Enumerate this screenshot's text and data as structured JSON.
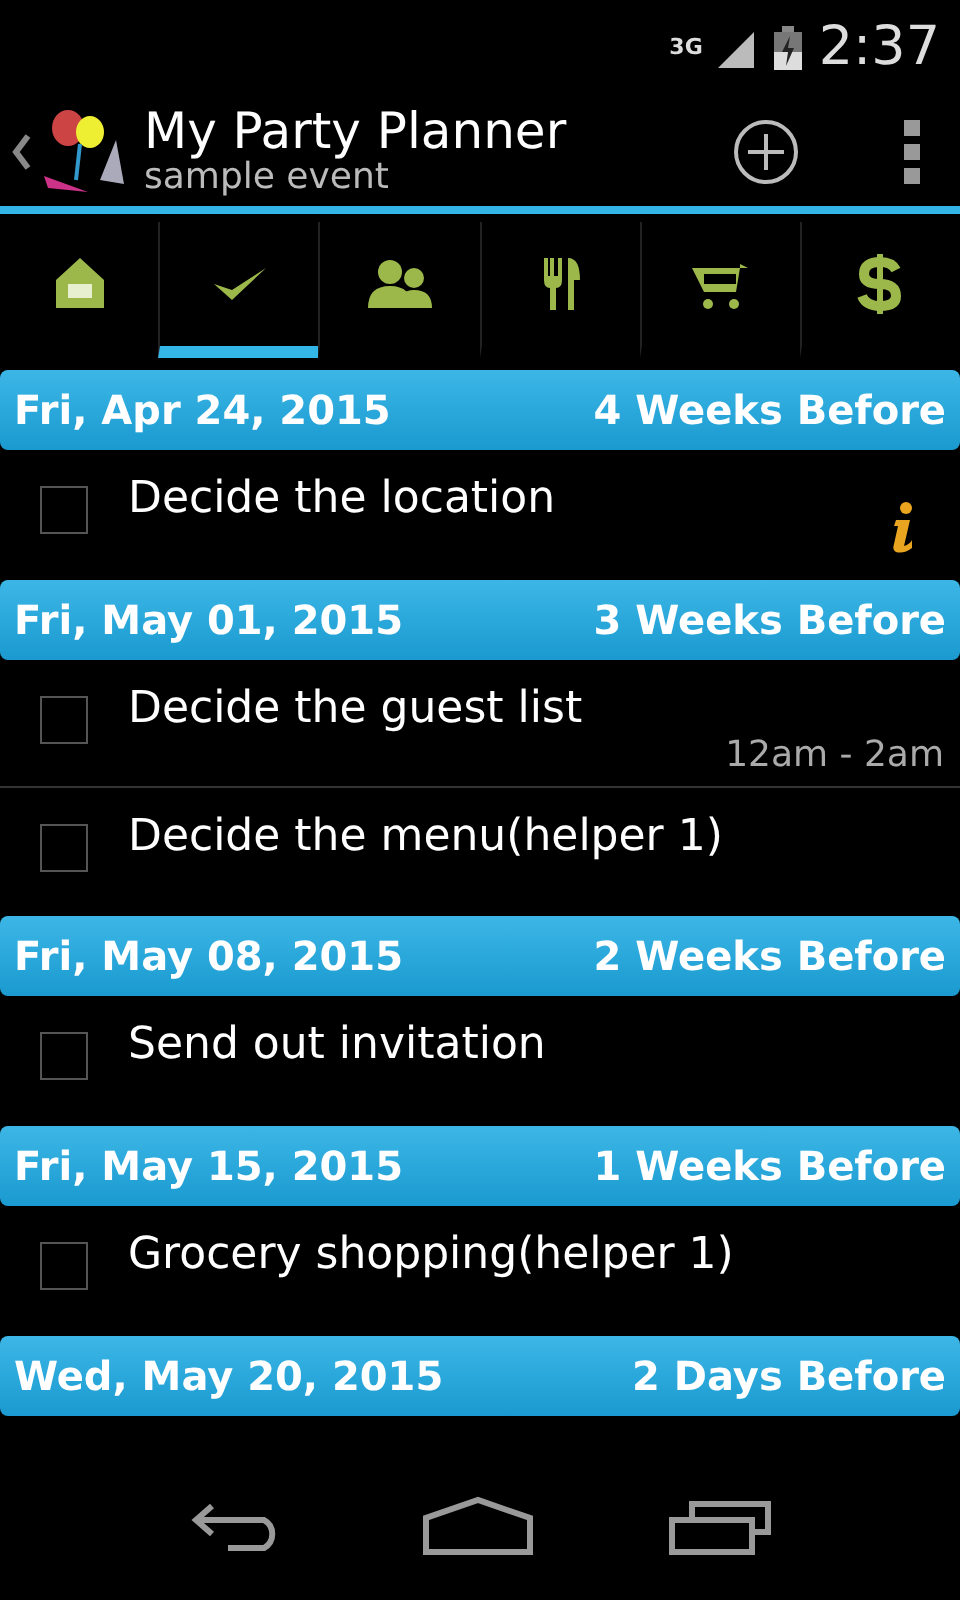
{
  "status_bar": {
    "network": "3G",
    "time": "2:37"
  },
  "action_bar": {
    "title": "My Party Planner",
    "subtitle": "sample event"
  },
  "tabs": [
    {
      "kind": "home",
      "selected": false
    },
    {
      "kind": "tasks",
      "selected": true
    },
    {
      "kind": "guests",
      "selected": false
    },
    {
      "kind": "menu",
      "selected": false
    },
    {
      "kind": "shopping",
      "selected": false
    },
    {
      "kind": "budget",
      "selected": false
    }
  ],
  "groups": [
    {
      "date": "Fri, Apr 24, 2015",
      "relative": "4 Weeks Before",
      "tasks": [
        {
          "text": "Decide the location",
          "checked": false,
          "info": true
        }
      ]
    },
    {
      "date": "Fri, May 01, 2015",
      "relative": "3 Weeks Before",
      "tasks": [
        {
          "text": "Decide the guest list",
          "checked": false,
          "time": "12am - 2am"
        },
        {
          "text": "Decide the menu(helper 1)",
          "checked": false
        }
      ]
    },
    {
      "date": "Fri, May 08, 2015",
      "relative": "2 Weeks Before",
      "tasks": [
        {
          "text": "Send out invitation",
          "checked": false
        }
      ]
    },
    {
      "date": "Fri, May 15, 2015",
      "relative": "1 Weeks Before",
      "tasks": [
        {
          "text": "Grocery shopping(helper 1)",
          "checked": false
        }
      ]
    },
    {
      "date": "Wed, May 20, 2015",
      "relative": "2 Days Before"
    }
  ]
}
